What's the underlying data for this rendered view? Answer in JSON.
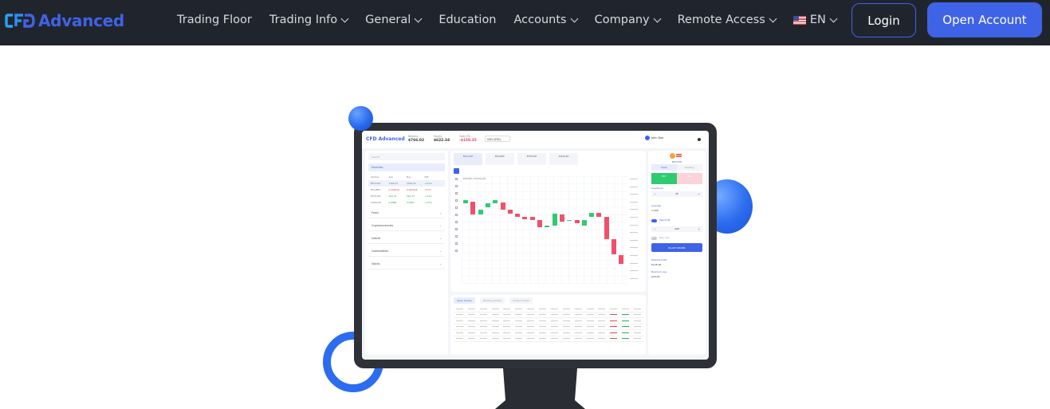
{
  "nav": {
    "brand": "Advanced",
    "brand_mark": "CFD",
    "items": [
      {
        "label": "Trading Floor",
        "dropdown": false
      },
      {
        "label": "Trading Info",
        "dropdown": true
      },
      {
        "label": "General",
        "dropdown": true
      },
      {
        "label": "Education",
        "dropdown": false
      },
      {
        "label": "Accounts",
        "dropdown": true
      },
      {
        "label": "Company",
        "dropdown": true
      },
      {
        "label": "Remote Access",
        "dropdown": true
      }
    ],
    "language": "EN",
    "login_label": "Login",
    "open_account_label": "Open Account",
    "colors": {
      "background": "#20252d",
      "accent": "#3f63e6",
      "text": "#d7dae0"
    }
  },
  "hero_app": {
    "brand": "CFD Advanced",
    "stats": [
      {
        "label": "Balance",
        "value": "$766.02"
      },
      {
        "label": "Equity",
        "value": "$622.34"
      },
      {
        "label": "Open P/L",
        "value": "-$159.35"
      }
    ],
    "account_select": "USD (SYD)",
    "user": "John Doe",
    "search_placeholder": "Search",
    "favorites_label": "Favorites",
    "watch_headers": [
      "Symbol",
      "Sell",
      "Buy",
      "Diff"
    ],
    "watch_rows": [
      {
        "symbol": "BTC/USD",
        "sell": "1166.25",
        "buy": "1166.23",
        "diff": "+0.5%"
      },
      {
        "symbol": "BTG/BTC",
        "sell": "0.000046",
        "buy": "0.000048",
        "diff": "-0.5%"
      },
      {
        "symbol": "ETH/USD",
        "sell": "944.31",
        "buy": "944.33",
        "diff": "+0.5%"
      },
      {
        "symbol": "AUD/CAD",
        "sell": "0.8986",
        "buy": "0.8987",
        "diff": "+0.5%"
      }
    ],
    "categories": [
      "Forex",
      "Cryptocurrencies",
      "Indices",
      "Commodities",
      "Stocks"
    ],
    "symbol_tabs": [
      "BTC/USD",
      "BTG/BTC",
      "ETH/USD",
      "AUD/CAD"
    ],
    "chart_title": "BITCOIN / US DOLLAR",
    "order_tabs": [
      "Open Orders",
      "Pending Orders",
      "Closed Orders"
    ],
    "trade_tabs": [
      "Trade",
      "Pending"
    ],
    "pair": "BTC/USD",
    "buy_label": "BUY",
    "sell_label": "SELL",
    "investment_label": "Investment",
    "investment_value": "25",
    "leverage_label": "Leverage",
    "leverage_value": "1:200",
    "take_profit_label": "Take Profit",
    "take_profit_value": "100",
    "stop_loss_label": "Stop Loss",
    "place_order_label": "PLACE ORDER",
    "potential_profit_label": "Potential Profit",
    "potential_profit_value": "$125.00",
    "maximum_loss_label": "Maximum Loss",
    "maximum_loss_value": "$25.00",
    "candles": [
      {
        "dir": "up",
        "o": 56,
        "c": 60
      },
      {
        "dir": "down",
        "o": 58,
        "c": 44
      },
      {
        "dir": "up",
        "o": 44,
        "c": 49
      },
      {
        "dir": "up",
        "o": 52,
        "c": 56
      },
      {
        "dir": "up",
        "o": 56,
        "c": 60
      },
      {
        "dir": "down",
        "o": 57,
        "c": 49
      },
      {
        "dir": "down",
        "o": 49,
        "c": 45
      },
      {
        "dir": "down",
        "o": 45,
        "c": 41
      },
      {
        "dir": "down",
        "o": 41,
        "c": 39
      },
      {
        "dir": "down",
        "o": 41,
        "c": 38
      },
      {
        "dir": "down",
        "o": 38,
        "c": 30
      },
      {
        "dir": "up",
        "o": 30,
        "c": 32
      },
      {
        "dir": "up",
        "o": 32,
        "c": 45
      },
      {
        "dir": "down",
        "o": 44,
        "c": 36
      },
      {
        "dir": "up",
        "o": 37,
        "c": 38
      },
      {
        "dir": "down",
        "o": 38,
        "c": 34
      },
      {
        "dir": "up",
        "o": 32,
        "c": 38
      },
      {
        "dir": "up",
        "o": 41,
        "c": 46
      },
      {
        "dir": "down",
        "o": 46,
        "c": 41
      },
      {
        "dir": "down",
        "o": 41,
        "c": 17
      },
      {
        "dir": "down",
        "o": 17,
        "c": 0
      },
      {
        "dir": "down",
        "o": 0,
        "c": -10
      }
    ]
  }
}
